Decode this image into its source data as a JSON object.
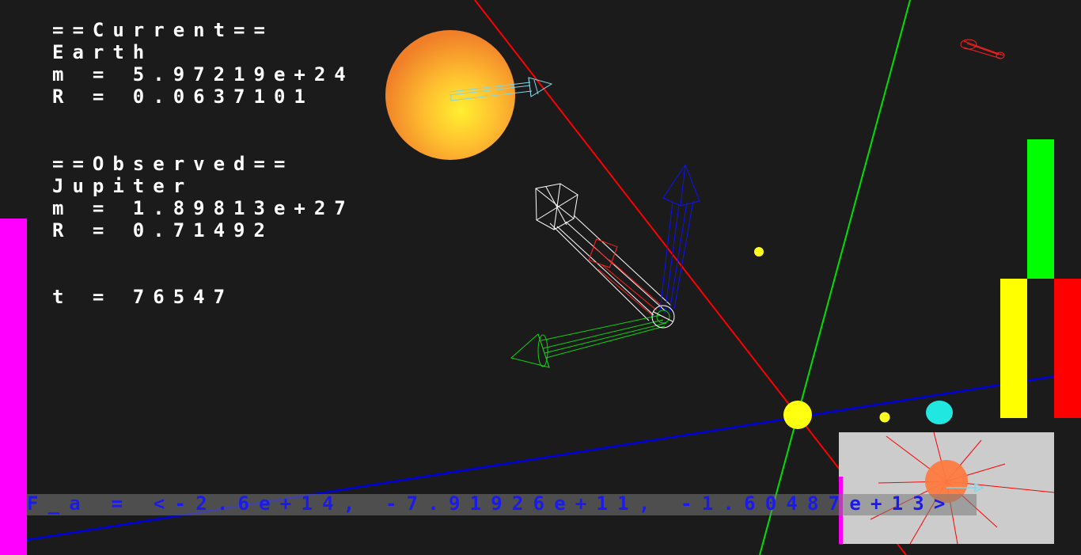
{
  "current": {
    "header": "==Current==",
    "name": "Earth",
    "mass": "m = 5.97219e+24",
    "radius": "R = 0.0637101"
  },
  "observed": {
    "header": "==Observed==",
    "name": "Jupiter",
    "mass": "m = 1.89813e+27",
    "radius": "R = 0.71492"
  },
  "time": "t = 76547",
  "force": "F_a = <-2.6e+14, -7.91926e+11, -1.60487e+13>",
  "colors": {
    "background": "#1b1b1b",
    "hud_text": "#ffffff",
    "force_text": "#1a1af0",
    "left_bar": "#ff00ff",
    "bar_green": "#00ff00",
    "bar_yellow": "#ffff00",
    "bar_red": "#ff0000",
    "minimap_bg": "#cccccc"
  },
  "bars": {
    "left_magenta_level": 0.6,
    "green_level": 0.5,
    "yellow_level": 0.5,
    "red_level": 0.5
  }
}
